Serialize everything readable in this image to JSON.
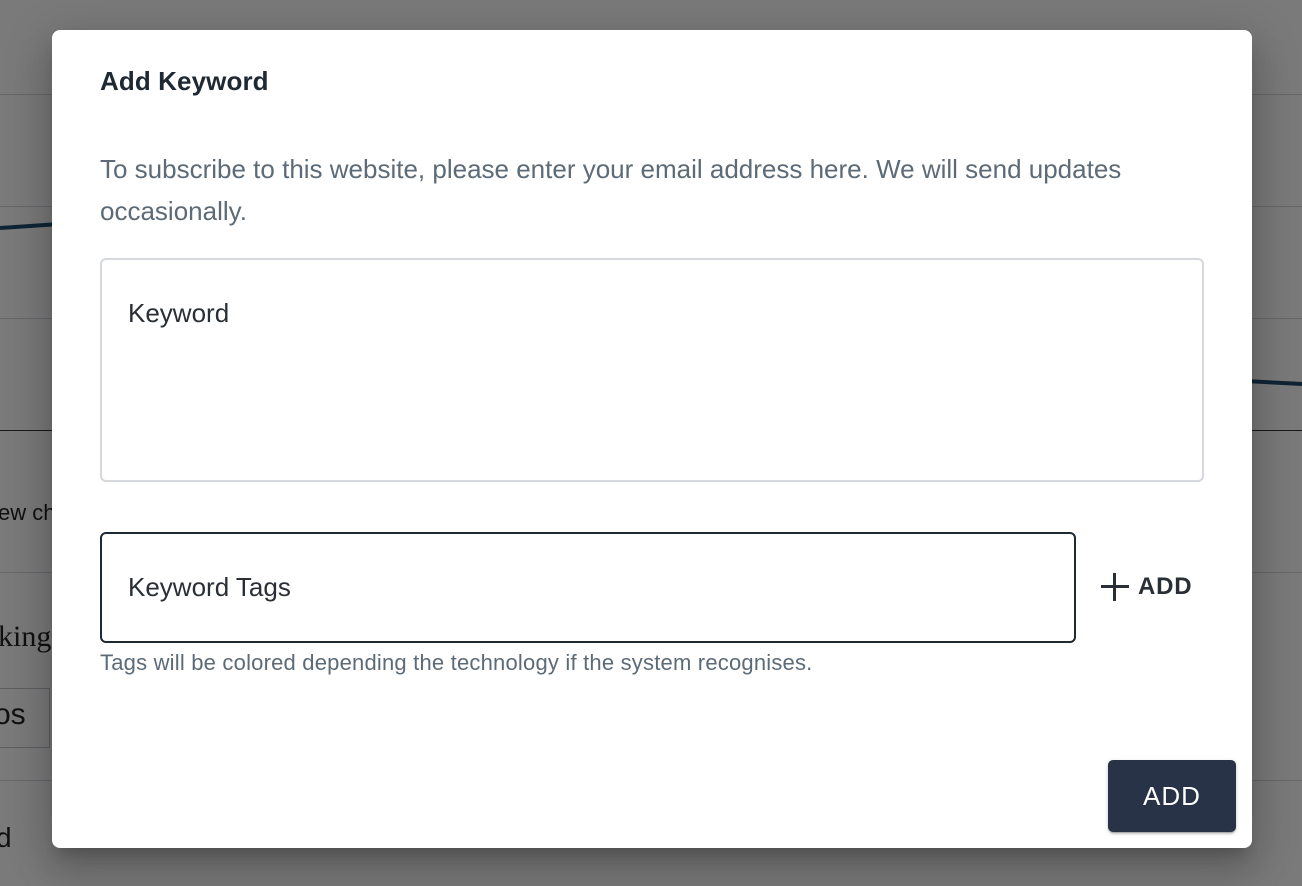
{
  "background": {
    "fragments": [
      "ew ch",
      "king",
      "os",
      "d"
    ]
  },
  "dialog": {
    "title": "Add Keyword",
    "description": "To subscribe to this website, please enter your email address here. We will send updates occasionally.",
    "keyword_field": {
      "placeholder": "Keyword",
      "value": ""
    },
    "tags_field": {
      "placeholder": "Keyword Tags",
      "value": "",
      "helper_text": "Tags will be colored depending the technology if the system recognises."
    },
    "add_tag_label": "ADD",
    "submit_label": "ADD"
  },
  "colors": {
    "primary_button": "#283347",
    "backdrop": "rgba(0,0,0,0.5)",
    "text_muted": "#5c6b77"
  },
  "icons": {
    "add_tag": "plus-icon"
  }
}
